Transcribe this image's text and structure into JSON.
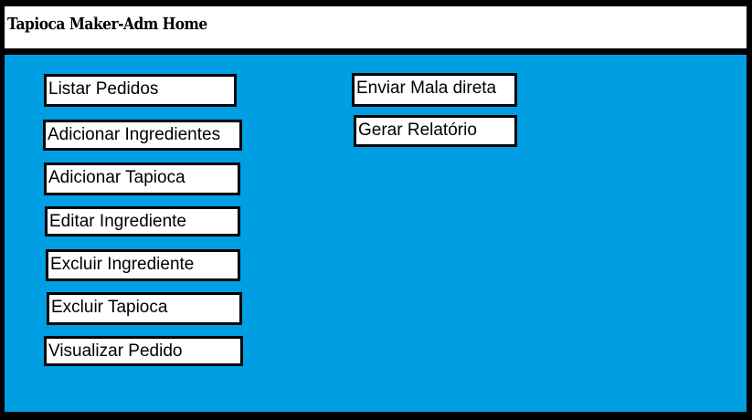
{
  "header": {
    "title": "Tapioca Maker-Adm Home"
  },
  "colors": {
    "background": "#009ee3",
    "frame": "#000000",
    "button": "#ffffff"
  },
  "menu": {
    "listar_pedidos": "Listar Pedidos",
    "adicionar_ingredientes": "Adicionar Ingredientes",
    "adicionar_tapioca": "Adicionar Tapioca",
    "editar_ingrediente": "Editar Ingrediente",
    "excluir_ingrediente": "Excluir Ingrediente",
    "excluir_tapioca": "Excluir Tapioca",
    "visualizar_pedido": "Visualizar Pedido",
    "enviar_mala_direta": "Enviar Mala direta",
    "gerar_relatorio": "Gerar Relatório"
  }
}
